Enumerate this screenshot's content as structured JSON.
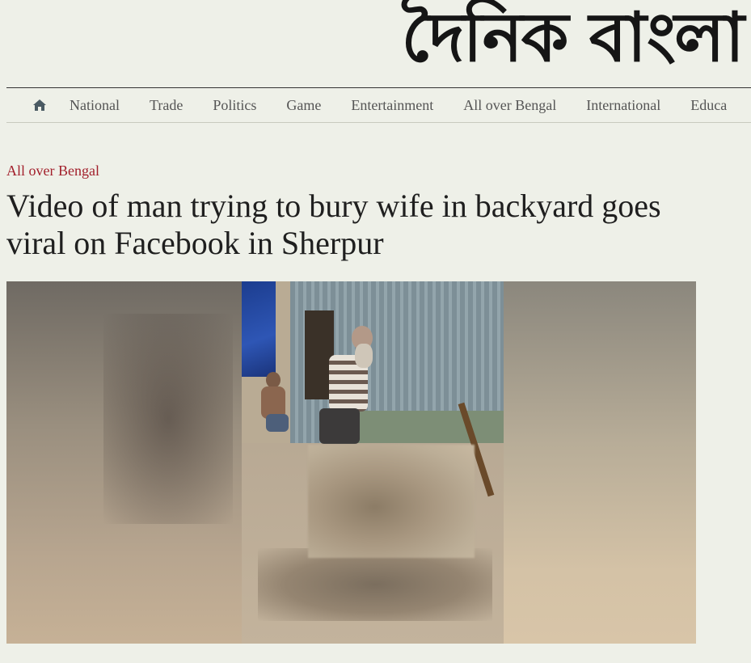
{
  "masthead": {
    "logo_text": "দৈনিক বাংলা"
  },
  "nav": {
    "home_icon": "home-icon",
    "items": [
      {
        "label": "National"
      },
      {
        "label": "Trade"
      },
      {
        "label": "Politics"
      },
      {
        "label": "Game"
      },
      {
        "label": "Entertainment"
      },
      {
        "label": "All over Bengal"
      },
      {
        "label": "International"
      },
      {
        "label": "Educa"
      }
    ]
  },
  "article": {
    "category": "All over Bengal",
    "headline": "Video of man trying to bury wife in backyard goes viral on Facebook in Sherpur",
    "image_icon": "article-photo"
  },
  "colors": {
    "background": "#eef0e8",
    "category": "#a21f2b",
    "nav_text": "#555555"
  }
}
